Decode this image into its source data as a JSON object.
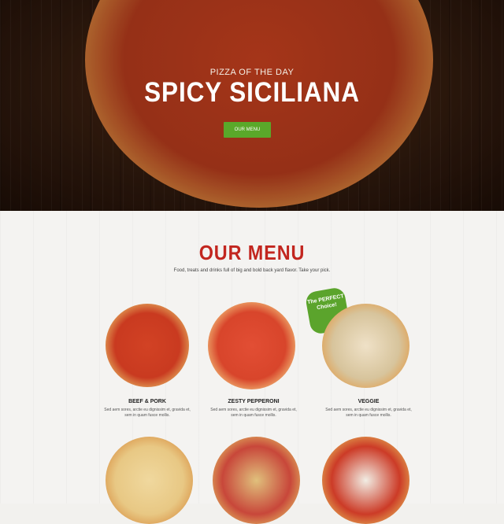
{
  "hero": {
    "kicker": "PIZZA OF THE DAY",
    "title": "SPICY SICILIANA",
    "button_label": "OUR MENU"
  },
  "menu": {
    "title": "OUR MENU",
    "subtitle": "Food, treats and drinks full of big and bold back yard flavor. Take your pick.",
    "badge_text": "The PERFECT Choice!",
    "items": [
      {
        "name": "BEEF & PORK",
        "desc": "Sed aem sores, arctie eu dignissim et, gravida et, sem in quam fusce mollis."
      },
      {
        "name": "ZESTY PEPPERONI",
        "desc": "Sed aem sores, arctie eu dignissim et, gravida et, sem in quam fusce mollis."
      },
      {
        "name": "VEGGIE",
        "desc": "Sed aem sores, arctie eu dignissim et, gravida et, sem in quam fusce mollis."
      }
    ]
  },
  "colors": {
    "accent_red": "#c2261f",
    "accent_green": "#5aa82a"
  }
}
